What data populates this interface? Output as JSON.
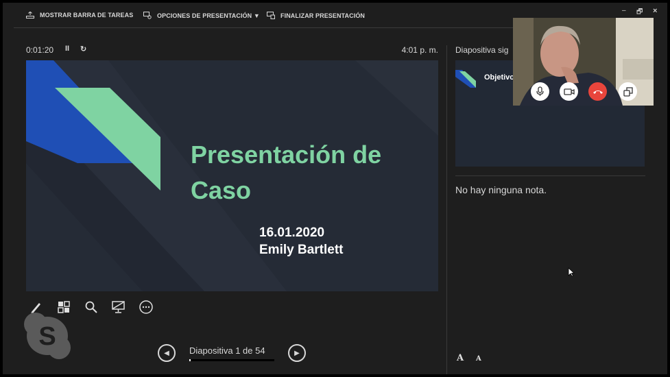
{
  "toolbar": {
    "show_taskbar": "MOSTRAR BARRA DE TAREAS",
    "presentation_options": "OPCIONES DE PRESENTACIÓN ▼",
    "end_presentation": "FINALIZAR PRESENTACIÓN"
  },
  "window_controls": {
    "minimize": "–",
    "restore": "🗗",
    "close": "×"
  },
  "timer": {
    "elapsed": "0:01:20",
    "pause": "II",
    "reset": "↻"
  },
  "clock": "4:01 p. m.",
  "current_slide": {
    "title": "Presentación de Caso",
    "date": "16.01.2020",
    "author": "Emily Bartlett",
    "colors": {
      "background": "#252b36",
      "title": "#7fd3a2",
      "accent_blue": "#1f4fb5",
      "accent_green": "#7fd3a2"
    }
  },
  "tools": [
    "pen-icon",
    "see-all-slides-icon",
    "zoom-icon",
    "black-screen-icon",
    "more-options-icon"
  ],
  "navigation": {
    "label": "Diapositiva 1 de 54",
    "prev_icon": "◀",
    "next_icon": "▶",
    "current": 1,
    "total": 54
  },
  "next_slide": {
    "label": "Diapositiva sig",
    "title": "Objetivo"
  },
  "notes": "No hay ninguna nota.",
  "font_controls": {
    "increase": "A",
    "decrease": "A"
  },
  "video_call": {
    "buttons": [
      "microphone-icon",
      "video-camera-icon",
      "hang-up-icon",
      "switch-window-icon"
    ]
  }
}
